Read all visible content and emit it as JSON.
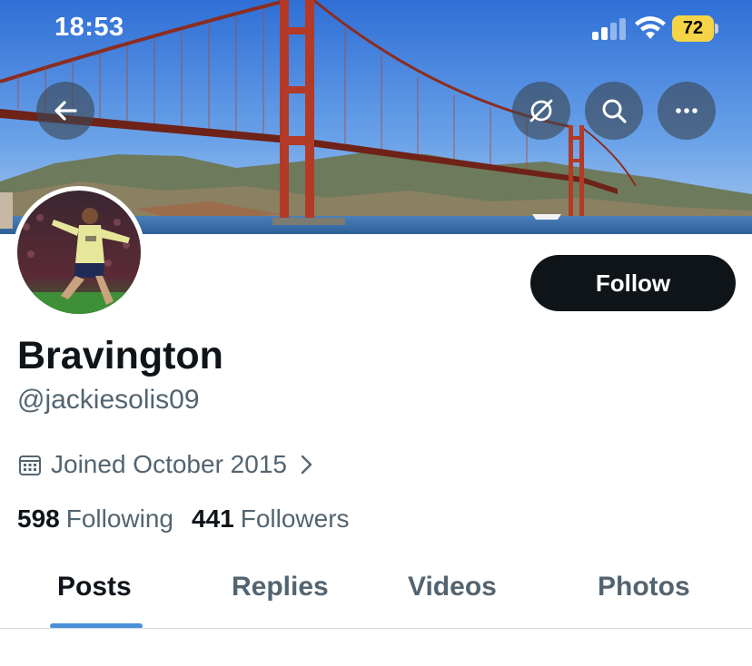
{
  "status_bar": {
    "time": "18:53",
    "battery": "72"
  },
  "header": {
    "back_icon": "arrow-left-icon",
    "grok_icon": "grok-icon",
    "search_icon": "search-icon",
    "more_icon": "more-horizontal-icon"
  },
  "profile": {
    "display_name": "Bravington",
    "handle": "@jackiesolis09",
    "follow_label": "Follow",
    "joined": "Joined October 2015",
    "following_count": "598",
    "following_label": "Following",
    "followers_count": "441",
    "followers_label": "Followers"
  },
  "tabs": [
    {
      "label": "Posts",
      "active": true
    },
    {
      "label": "Replies",
      "active": false
    },
    {
      "label": "Videos",
      "active": false
    },
    {
      "label": "Photos",
      "active": false
    }
  ],
  "colors": {
    "accent": "#4a90d9",
    "text_primary": "#0f1419",
    "text_secondary": "#536471",
    "battery": "#f5d547"
  }
}
